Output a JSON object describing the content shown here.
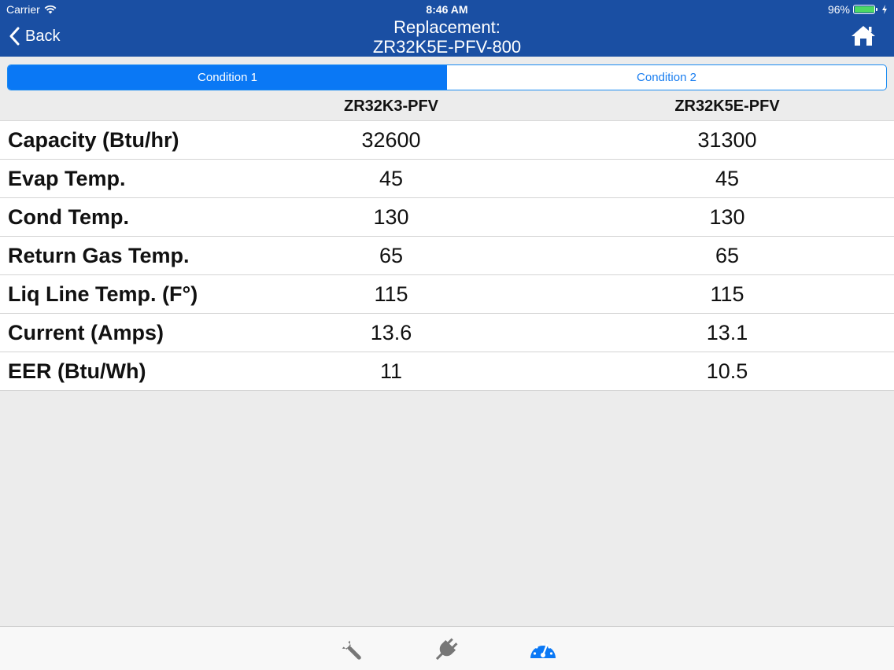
{
  "status_bar": {
    "carrier": "Carrier",
    "time": "8:46 AM",
    "battery_percent": "96%",
    "battery_level": 0.96
  },
  "nav": {
    "back_label": "Back",
    "title_line1": "Replacement:",
    "title_line2": "ZR32K5E-PFV-800"
  },
  "segments": [
    {
      "label": "Condition 1",
      "active": true
    },
    {
      "label": "Condition 2",
      "active": false
    }
  ],
  "table": {
    "columns": [
      "ZR32K3-PFV",
      "ZR32K5E-PFV"
    ],
    "rows": [
      {
        "label": "Capacity (Btu/hr)",
        "values": [
          "32600",
          "31300"
        ]
      },
      {
        "label": "Evap Temp.",
        "values": [
          "45",
          "45"
        ]
      },
      {
        "label": "Cond Temp.",
        "values": [
          "130",
          "130"
        ]
      },
      {
        "label": "Return Gas Temp.",
        "values": [
          "65",
          "65"
        ]
      },
      {
        "label": "Liq Line Temp. (F°)",
        "values": [
          "115",
          "115"
        ]
      },
      {
        "label": "Current (Amps)",
        "values": [
          "13.6",
          "13.1"
        ]
      },
      {
        "label": "EER (Btu/Wh)",
        "values": [
          "11",
          "10.5"
        ]
      }
    ]
  },
  "tabbar": {
    "items": [
      {
        "icon": "wrench-icon",
        "active": false
      },
      {
        "icon": "plug-icon",
        "active": false
      },
      {
        "icon": "gauge-icon",
        "active": true
      }
    ],
    "active_color": "#0a78f5",
    "inactive_color": "#777777"
  },
  "colors": {
    "nav_bg": "#1a4fa3",
    "accent": "#0a78f5"
  }
}
